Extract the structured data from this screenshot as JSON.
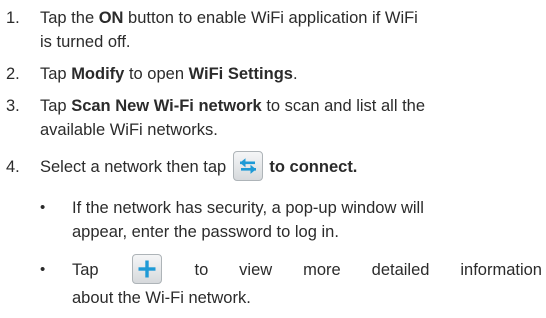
{
  "steps": [
    {
      "number": "1.",
      "prefix": "Tap the ",
      "bold1": "ON",
      "middle": " button to enable WiFi application if WiFi",
      "line2": "is turned off."
    },
    {
      "number": "2.",
      "prefix": "Tap ",
      "bold1": "Modify",
      "middle": " to open ",
      "bold2": "WiFi Settings",
      "suffix": "."
    },
    {
      "number": "3.",
      "prefix": "Tap ",
      "bold1": "Scan New Wi-Fi network",
      "middle": " to scan and list all the",
      "line2": "available WiFi networks."
    },
    {
      "number": "4.",
      "prefix": "Select a network then tap",
      "suffix": "to connect."
    }
  ],
  "bullets": [
    {
      "symbol": "•",
      "line1": "If the network has security, a pop-up window will",
      "line2": "appear, enter the password to log in."
    },
    {
      "symbol": "•",
      "prefix": "Tap",
      "suffix": "to view more detailed information",
      "line2": "about the Wi-Fi network."
    }
  ],
  "icons": {
    "connect": "swap-arrows-icon",
    "details": "plus-icon",
    "accent": "#1e9ad6"
  }
}
